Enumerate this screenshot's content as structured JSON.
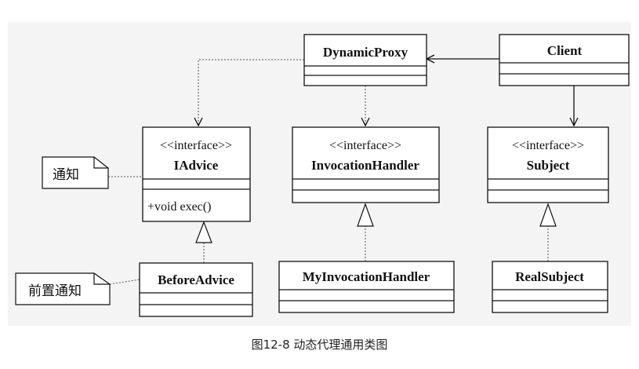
{
  "classes": {
    "dynamic_proxy": {
      "name": "DynamicProxy"
    },
    "client": {
      "name": "Client"
    },
    "iadvice": {
      "stereotype": "<<interface>>",
      "name": "IAdvice",
      "method": "+void exec()"
    },
    "invocation_handler": {
      "stereotype": "<<interface>>",
      "name": "InvocationHandler"
    },
    "subject": {
      "stereotype": "<<interface>>",
      "name": "Subject"
    },
    "before_advice": {
      "name": "BeforeAdvice"
    },
    "my_invocation_handler": {
      "name": "MyInvocationHandler"
    },
    "real_subject": {
      "name": "RealSubject"
    }
  },
  "notes": {
    "advice_note": "通知",
    "before_advice_note": "前置通知"
  },
  "caption": "图12-8 动态代理通用类图"
}
